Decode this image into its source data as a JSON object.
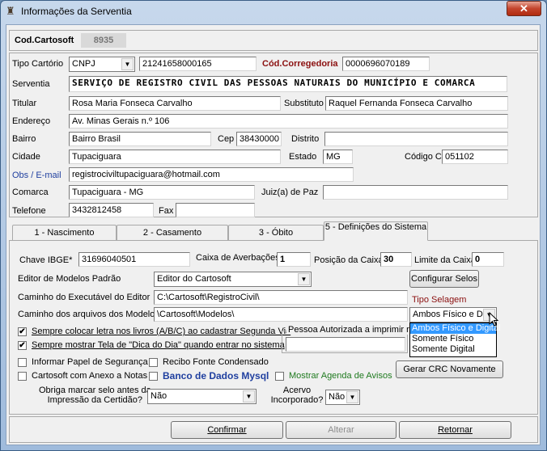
{
  "window": {
    "title": "Informações da Serventia",
    "close": "✕"
  },
  "cod": {
    "label": "Cod.Cartosoft",
    "value": "8935"
  },
  "form": {
    "tipo_cartorio": {
      "label": "Tipo Cartório",
      "value": "CNPJ",
      "number": "21241658000165"
    },
    "cod_corregedoria": {
      "label": "Cód.Corregedoria",
      "value": "0000696070189"
    },
    "serventia": {
      "label": "Serventia",
      "value": "SERVIÇO DE REGISTRO CIVIL DAS PESSOAS NATURAIS DO MUNICÍPIO E COMARCA"
    },
    "titular": {
      "label": "Titular",
      "value": "Rosa Maria Fonseca Carvalho"
    },
    "substituto": {
      "label": "Substituto",
      "value": "Raquel Fernanda Fonseca Carvalho"
    },
    "endereco": {
      "label": "Endereço",
      "value": "Av. Minas Gerais n.º 106"
    },
    "bairro": {
      "label": "Bairro",
      "value": "Bairro Brasil"
    },
    "cep": {
      "label": "Cep",
      "value": "38430000"
    },
    "distrito": {
      "label": "Distrito",
      "value": ""
    },
    "cidade": {
      "label": "Cidade",
      "value": "Tupaciguara"
    },
    "estado": {
      "label": "Estado",
      "value": "MG"
    },
    "cns": {
      "label": "Código CNS",
      "value": "051102"
    },
    "email": {
      "label": "Obs / E-mail",
      "value": "registrociviltupaciguara@hotmail.com"
    },
    "comarca": {
      "label": "Comarca",
      "value": "Tupaciguara - MG"
    },
    "juiz": {
      "label": "Juiz(a) de Paz",
      "value": ""
    },
    "telefone": {
      "label": "Telefone",
      "value": "3432812458"
    },
    "fax": {
      "label": "Fax",
      "value": ""
    }
  },
  "tabs": [
    {
      "label": "1 - Nascimento"
    },
    {
      "label": "2 - Casamento"
    },
    {
      "label": "3 - Óbito"
    },
    {
      "label": "5 - Definições do Sistema"
    }
  ],
  "sistema": {
    "chave_ibge": {
      "label": "Chave IBGE*",
      "value": "31696040501"
    },
    "caixa_averbacoes": {
      "label": "Caixa de Averbações",
      "value": "1"
    },
    "posicao_caixa": {
      "label": "Posição da Caixa",
      "value": "30"
    },
    "limite_caixa": {
      "label": "Limite da Caixa",
      "value": "0"
    },
    "editor_modelos": {
      "label": "Editor de Modelos Padrão",
      "value": "Editor do Cartosoft"
    },
    "configurar_selos": "Configurar Selos",
    "caminho_editor": {
      "label": "Caminho do Executável do Editor",
      "value": "C:\\Cartosoft\\RegistroCivil\\"
    },
    "tipo_selagem": {
      "label": "Tipo Selagem",
      "value": "Ambos Físico e Dig",
      "options": [
        "Ambos Físico e Digital",
        "Somente Físico",
        "Somente Digital"
      ]
    },
    "caminho_modelos": {
      "label": "Caminho dos  arquivos dos Modelos",
      "value": "\\Cartosoft\\Modelos\\"
    },
    "chk_letra": "Sempre colocar letra nos livros (A/B/C) ao cadastrar Segunda Via",
    "chk_dica": "Sempre mostrar Tela de \"Dica do Dia\" quando entrar no sistema",
    "pessoa_autorizada": "Pessoa Autorizada a imprimir requ",
    "chk_papel": "Informar Papel de Segurança",
    "chk_recibo": "Recibo Fonte Condensado",
    "chk_anexo": "Cartosoft com Anexo a Notas",
    "chk_banco": "Banco de Dados Mysql",
    "chk_agenda": "Mostrar Agenda de Avisos",
    "gerar_crc": "Gerar CRC Novamente",
    "obriga_selo": {
      "label1": "Obriga marcar selo antes da",
      "label2": "Impressão da Certidão?",
      "value": "Não"
    },
    "acervo": {
      "label1": "Acervo",
      "label2": "Incorporado?",
      "value": "Não"
    }
  },
  "footer": {
    "confirmar": "Confirmar",
    "alterar": "Alterar",
    "retornar": "Retornar"
  },
  "colors": {
    "accent_red": "#8b1010",
    "email_blue": "#1f3f9f",
    "mysql_blue": "#1f3f9f",
    "agenda_green": "#1f7a1f",
    "highlight": "#3399ff"
  }
}
